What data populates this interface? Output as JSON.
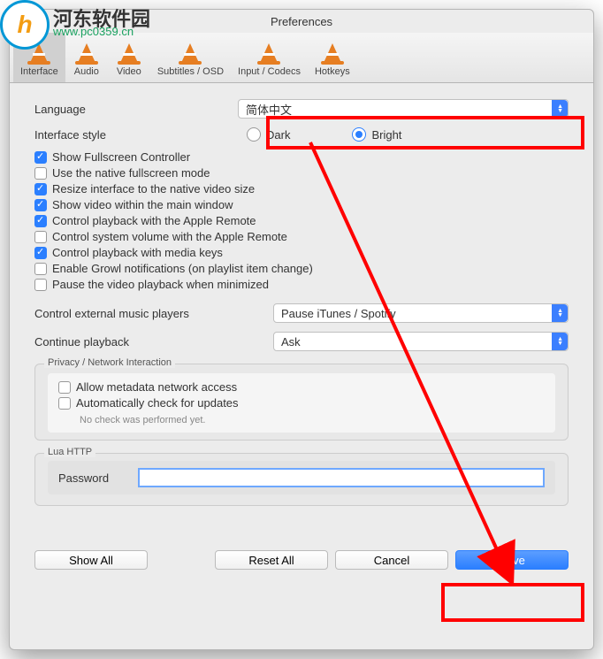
{
  "window": {
    "title": "Preferences"
  },
  "toolbar": {
    "items": [
      {
        "label": "Interface"
      },
      {
        "label": "Audio"
      },
      {
        "label": "Video"
      },
      {
        "label": "Subtitles / OSD"
      },
      {
        "label": "Input / Codecs"
      },
      {
        "label": "Hotkeys"
      }
    ]
  },
  "language": {
    "label": "Language",
    "value": "简体中文"
  },
  "interface_style": {
    "label": "Interface style",
    "dark": "Dark",
    "bright": "Bright",
    "selected": "bright"
  },
  "checks": [
    {
      "label": "Show Fullscreen Controller",
      "checked": true
    },
    {
      "label": "Use the native fullscreen mode",
      "checked": false
    },
    {
      "label": "Resize interface to the native video size",
      "checked": true
    },
    {
      "label": "Show video within the main window",
      "checked": true
    },
    {
      "label": "Control playback with the Apple Remote",
      "checked": true
    },
    {
      "label": "Control system volume with the Apple Remote",
      "checked": false
    },
    {
      "label": "Control playback with media keys",
      "checked": true
    },
    {
      "label": "Enable Growl notifications (on playlist item change)",
      "checked": false
    },
    {
      "label": "Pause the video playback when minimized",
      "checked": false
    }
  ],
  "music_control": {
    "label": "Control external music players",
    "value": "Pause iTunes / Spotify"
  },
  "continue_playback": {
    "label": "Continue playback",
    "value": "Ask"
  },
  "privacy": {
    "legend": "Privacy / Network Interaction",
    "metadata": "Allow metadata network access",
    "updates": "Automatically check for updates",
    "hint": "No check was performed yet."
  },
  "lua": {
    "legend": "Lua HTTP",
    "password_label": "Password",
    "password_value": ""
  },
  "buttons": {
    "show_all": "Show All",
    "reset_all": "Reset All",
    "cancel": "Cancel",
    "save": "Save"
  },
  "watermark": {
    "text": "河东软件园",
    "url": "www.pc0359.cn"
  }
}
